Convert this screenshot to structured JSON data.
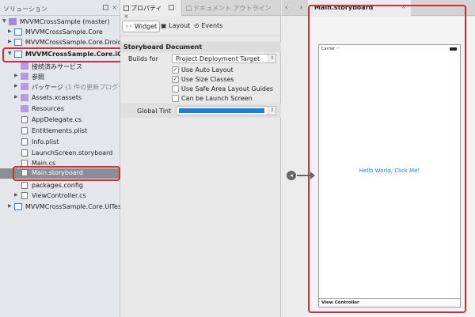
{
  "solution": {
    "header": "ソリューション",
    "items": [
      {
        "label": "MVVMCrossSample (master)"
      },
      {
        "label": "MVVMCrossSample.Core"
      },
      {
        "label": "MVVMCrossSample.Core.Droid"
      },
      {
        "label": "MVVMCrossSample.Core.iOS"
      },
      {
        "label": "接続済みサービス"
      },
      {
        "label": "参照"
      },
      {
        "label": "パッケージ",
        "note": "(1 件の更新プログラ..."
      },
      {
        "label": "Assets.xcassets"
      },
      {
        "label": "Resources"
      },
      {
        "label": "AppDelegate.cs"
      },
      {
        "label": "Entitlements.plist"
      },
      {
        "label": "Info.plist"
      },
      {
        "label": "LaunchScreen.storyboard"
      },
      {
        "label": "Main.cs"
      },
      {
        "label": "Main.storyboard"
      },
      {
        "label": "packages.config"
      },
      {
        "label": "ViewController.cs"
      },
      {
        "label": "MVVMCrossSample.Core.UITests"
      }
    ]
  },
  "properties": {
    "tab_properties": "プロパティ",
    "tab_outline": "ドキュメント アウトライン",
    "toolbar": {
      "widget": "Widget",
      "layout": "Layout",
      "events": "Events"
    },
    "section": "Storyboard Document",
    "builds_for_label": "Builds for",
    "builds_for_value": "Project Deployment Target",
    "checkboxes": [
      {
        "label": "Use Auto Layout",
        "checked": true
      },
      {
        "label": "Use Size Classes",
        "checked": true
      },
      {
        "label": "Use Safe Area Layout Guides",
        "checked": false
      },
      {
        "label": "Can be Launch Screen",
        "checked": false
      }
    ],
    "global_tint_label": "Global Tint",
    "global_tint_color": "#1e7fd8"
  },
  "editor": {
    "tab_title": "Main.storyboard",
    "status_carrier": "Carrier",
    "button_text": "Hello World, Click Me!",
    "footer": "View Controller",
    "accent": "#d8283a"
  }
}
